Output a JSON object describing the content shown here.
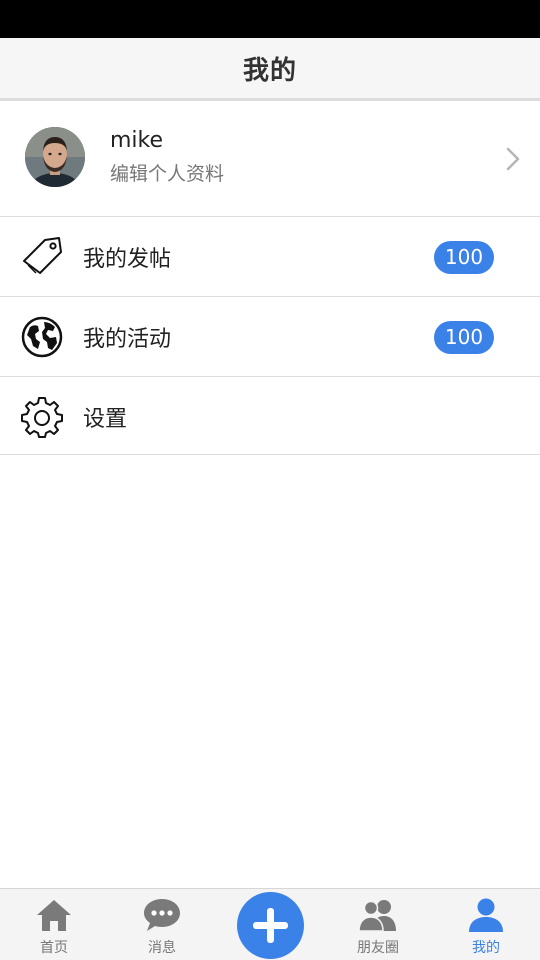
{
  "header": {
    "title": "我的"
  },
  "profile": {
    "name": "mike",
    "subtitle": "编辑个人资料"
  },
  "menu": [
    {
      "label": "我的发帖",
      "badge": "100",
      "icon": "tag-icon"
    },
    {
      "label": "我的活动",
      "badge": "100",
      "icon": "globe-icon"
    },
    {
      "label": "设置",
      "icon": "gear-icon"
    }
  ],
  "tabbar": {
    "active": "我的",
    "accent_color": "#3b82e8",
    "items": [
      {
        "label": "首页",
        "icon": "home-icon"
      },
      {
        "label": "消息",
        "icon": "chat-icon"
      },
      {
        "label": "",
        "icon": "plus-icon"
      },
      {
        "label": "朋友圈",
        "icon": "friends-icon"
      },
      {
        "label": "我的",
        "icon": "user-icon"
      }
    ]
  }
}
